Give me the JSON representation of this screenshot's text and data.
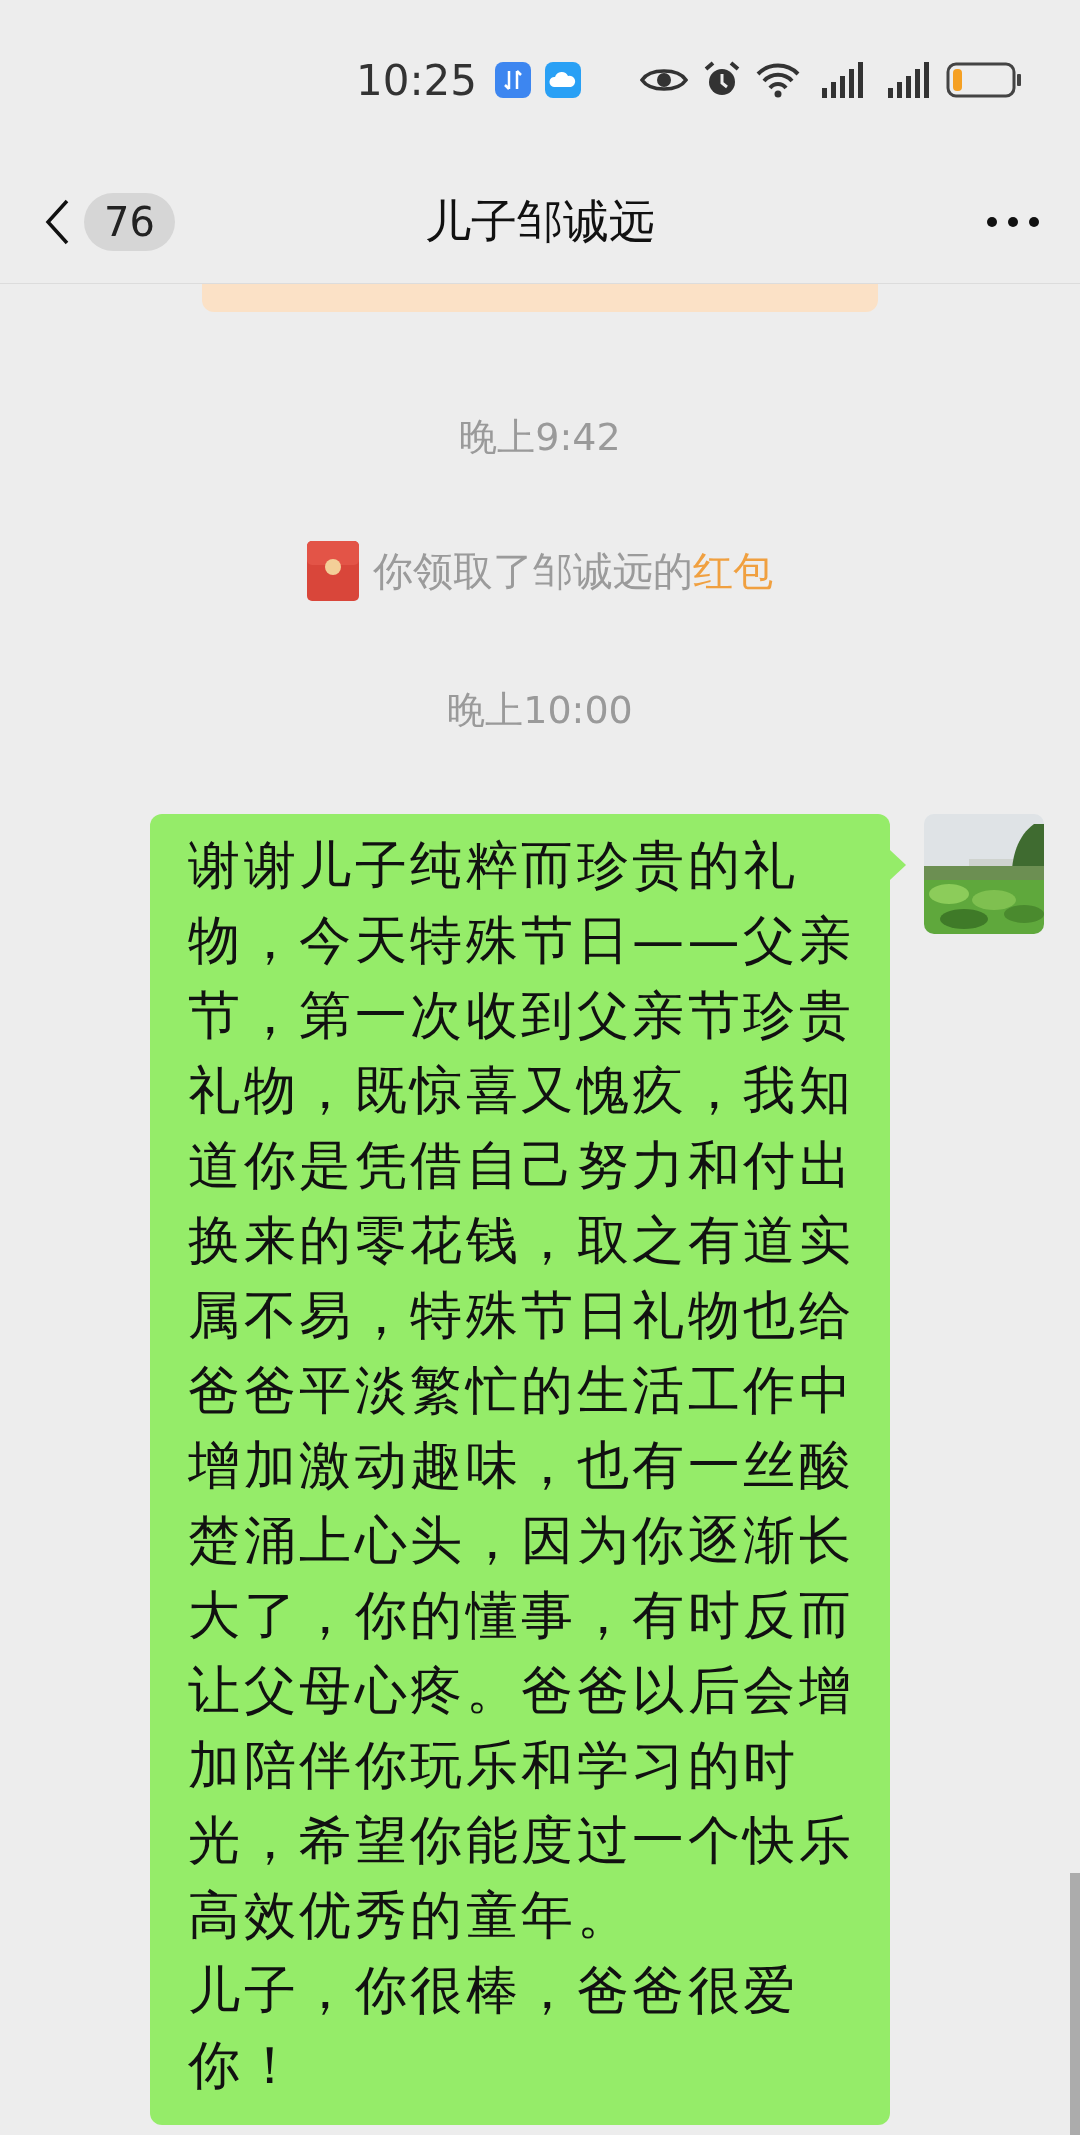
{
  "status_bar": {
    "time": "10:25"
  },
  "header": {
    "unread_count": "76",
    "title": "儿子邹诚远"
  },
  "messages": [
    {
      "kind": "partial_bubble"
    },
    {
      "kind": "time",
      "text": "晚上9:42"
    },
    {
      "kind": "system",
      "text": "你领取了邹诚远的",
      "link": "红包"
    },
    {
      "kind": "time",
      "text": "晚上10:00"
    },
    {
      "kind": "outgoing",
      "paragraphs": [
        "谢谢儿子纯粹而珍贵的礼物，今天特殊节日——父亲节，第一次收到父亲节珍贵礼物，既惊喜又愧疚，我知道你是凭借自己努力和付出换来的零花钱，取之有道实属不易，特殊节日礼物也给爸爸平淡繁忙的生活工作中增加激动趣味，也有一丝酸楚涌上心头，因为你逐渐长大了，你的懂事，有时反而让父母心疼。爸爸以后会增加陪伴你玩乐和学习的时光，希望你能度过一个快乐高效优秀的童年。",
        "儿子，你很棒，爸爸很爱你！"
      ]
    }
  ]
}
